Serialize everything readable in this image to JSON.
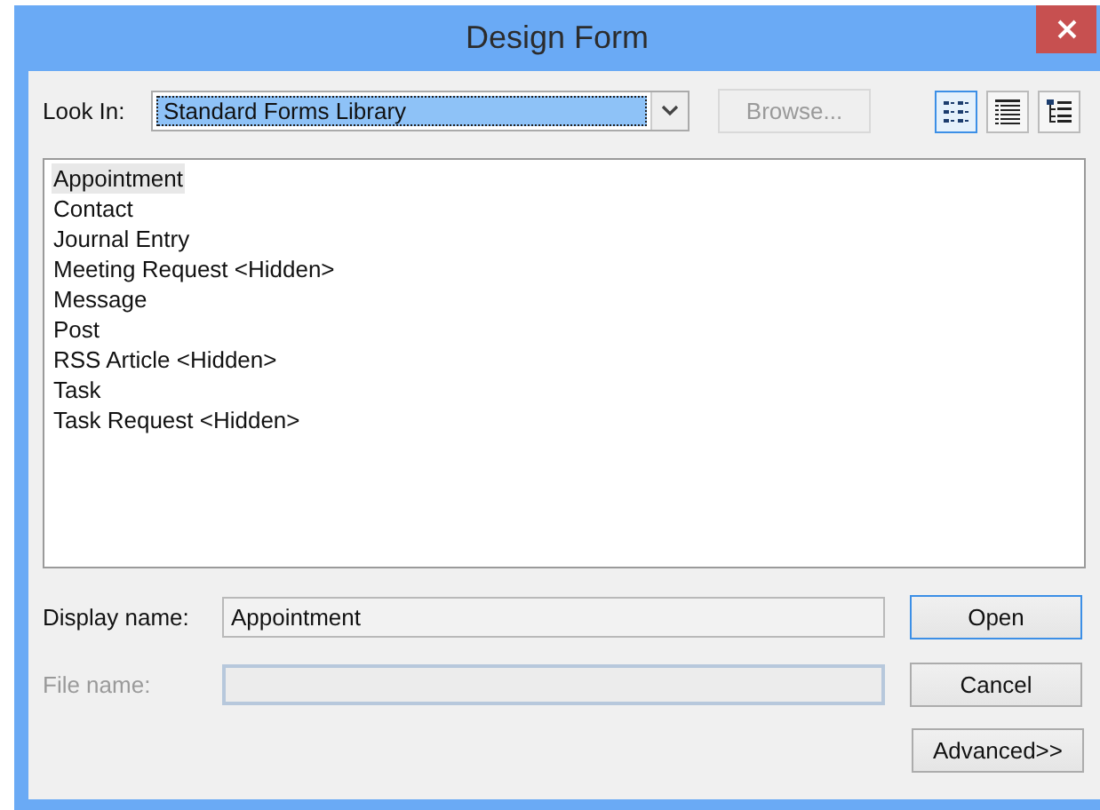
{
  "window": {
    "title": "Design Form"
  },
  "look_in": {
    "label": "Look In:",
    "value": "Standard Forms Library"
  },
  "browse_button": {
    "label": "Browse...",
    "disabled": true
  },
  "view_buttons": [
    {
      "kind": "icons",
      "selected": true
    },
    {
      "kind": "details",
      "selected": false
    },
    {
      "kind": "tree",
      "selected": false
    }
  ],
  "forms": [
    {
      "label": "Appointment",
      "selected": true
    },
    {
      "label": "Contact",
      "selected": false
    },
    {
      "label": "Journal Entry",
      "selected": false
    },
    {
      "label": "Meeting Request <Hidden>",
      "selected": false
    },
    {
      "label": "Message",
      "selected": false
    },
    {
      "label": "Post",
      "selected": false
    },
    {
      "label": "RSS Article <Hidden>",
      "selected": false
    },
    {
      "label": "Task",
      "selected": false
    },
    {
      "label": "Task Request <Hidden>",
      "selected": false
    }
  ],
  "display_name": {
    "label": "Display name:",
    "value": "Appointment",
    "disabled": false
  },
  "file_name": {
    "label": "File name:",
    "disabled": true
  },
  "buttons": [
    {
      "label": "Open",
      "default": true
    },
    {
      "label": "Cancel",
      "default": false
    },
    {
      "label": "Advanced>>",
      "default": false
    }
  ]
}
